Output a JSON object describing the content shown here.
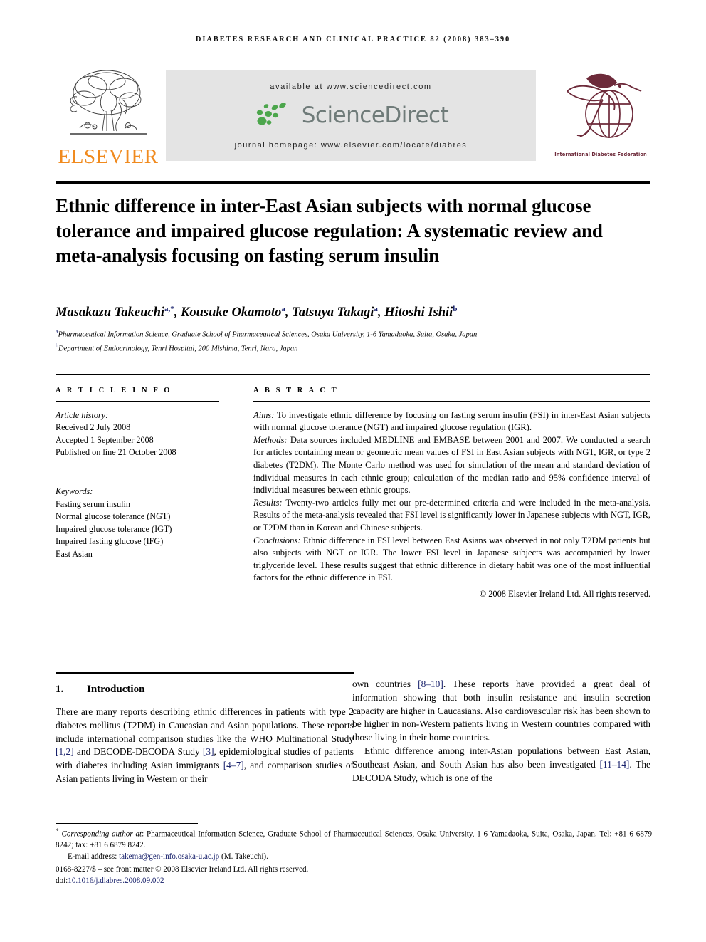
{
  "running_head": "DIABETES RESEARCH AND CLINICAL PRACTICE 82 (2008) 383–390",
  "masthead": {
    "publisher_name": "ELSEVIER",
    "available_at": "available at www.sciencedirect.com",
    "sciencedirect_wordmark": "ScienceDirect",
    "journal_homepage": "journal homepage: www.elsevier.com/locate/diabres",
    "idf_caption": "International Diabetes Federation",
    "colors": {
      "elsevier_orange": "#f08a1e",
      "sciencedirect_green": "#4ca64c",
      "sciencedirect_gray": "#6f7b79",
      "idf_maroon": "#6d2a3a",
      "band_gray": "#e4e4e4",
      "link_blue": "#18216b"
    }
  },
  "article": {
    "title": "Ethnic difference in inter-East Asian subjects with normal glucose tolerance and impaired glucose regulation: A systematic review and meta-analysis focusing on fasting serum insulin",
    "authors_html": "Masakazu Takeuchi<sup>a,*</sup>, Kousuke Okamoto<sup>a</sup>, Tatsuya Takagi<sup>a</sup>, Hitoshi Ishii<sup>b</sup>",
    "affiliations": [
      "Pharmaceutical Information Science, Graduate School of Pharmaceutical Sciences, Osaka University, 1-6 Yamadaoka, Suita, Osaka, Japan",
      "Department of Endocrinology, Tenri Hospital, 200 Mishima, Tenri, Nara, Japan"
    ],
    "affiliation_marks": [
      "a",
      "b"
    ]
  },
  "article_info": {
    "heading": "A R T I C L E  I N F O",
    "history_label": "Article history:",
    "history": [
      "Received 2 July 2008",
      "Accepted 1 September 2008",
      "Published on line 21 October 2008"
    ],
    "keywords_label": "Keywords:",
    "keywords": [
      "Fasting serum insulin",
      "Normal glucose tolerance (NGT)",
      "Impaired glucose tolerance (IGT)",
      "Impaired fasting glucose (IFG)",
      "East Asian"
    ]
  },
  "abstract": {
    "heading": "A B S T R A C T",
    "sections": [
      {
        "label": "Aims:",
        "text": " To investigate ethnic difference by focusing on fasting serum insulin (FSI) in inter-East Asian subjects with normal glucose tolerance (NGT) and impaired glucose regulation (IGR)."
      },
      {
        "label": "Methods:",
        "text": " Data sources included MEDLINE and EMBASE between 2001 and 2007. We conducted a search for articles containing mean or geometric mean values of FSI in East Asian subjects with NGT, IGR, or type 2 diabetes (T2DM). The Monte Carlo method was used for simulation of the mean and standard deviation of individual measures in each ethnic group; calculation of the median ratio and 95% confidence interval of individual measures between ethnic groups."
      },
      {
        "label": "Results:",
        "text": " Twenty-two articles fully met our pre-determined criteria and were included in the meta-analysis. Results of the meta-analysis revealed that FSI level is significantly lower in Japanese subjects with NGT, IGR, or T2DM than in Korean and Chinese subjects."
      },
      {
        "label": "Conclusions:",
        "text": " Ethnic difference in FSI level between East Asians was observed in not only T2DM patients but also subjects with NGT or IGR. The lower FSI level in Japanese subjects was accompanied by lower triglyceride level. These results suggest that ethnic difference in dietary habit was one of the most influential factors for the ethnic difference in FSI."
      }
    ],
    "copyright": "© 2008 Elsevier Ireland Ltd. All rights reserved."
  },
  "introduction": {
    "number": "1.",
    "title": "Introduction",
    "left_column_html": "There are many reports describing ethnic differences in patients with type 2 diabetes mellitus (T2DM) in Caucasian and Asian populations. These reports include international comparison studies like the WHO Multinational Study <span class=\"cite\">[1,2]</span> and DECODE-DECODA Study <span class=\"cite\">[3]</span>, epidemiological studies of patients with diabetes including Asian immigrants <span class=\"cite\">[4–7]</span>, and comparison studies of Asian patients living in Western or their",
    "right_column_html_p1": "own countries <span class=\"cite\">[8–10]</span>. These reports have provided a great deal of information showing that both insulin resistance and insulin secretion capacity are higher in Caucasians. Also cardiovascular risk has been shown to be higher in non-Western patients living in Western countries compared with those living in their home countries.",
    "right_column_html_p2": "Ethnic difference among inter-Asian populations between East Asian, Southeast Asian, and South Asian has also been investigated <span class=\"cite\">[11–14]</span>. The DECODA Study, which is one of the"
  },
  "footnote": {
    "corresponding_html": "<span class=\"it\">Corresponding author at</span>: Pharmaceutical Information Science, Graduate School of Pharmaceutical Sciences, Osaka University, 1-6 Yamadaoka, Suita, Osaka, Japan. Tel: +81 6 6879 8242; fax: +81 6 6879 8242.",
    "email_html": "E-mail address: <span class=\"link\">takema@gen-info.osaka-u.ac.jp</span> (M. Takeuchi).",
    "issn_line": "0168-8227/$ – see front matter © 2008 Elsevier Ireland Ltd. All rights reserved.",
    "doi_html": "doi:<span class=\"link\">10.1016/j.diabres.2008.09.002</span>"
  }
}
